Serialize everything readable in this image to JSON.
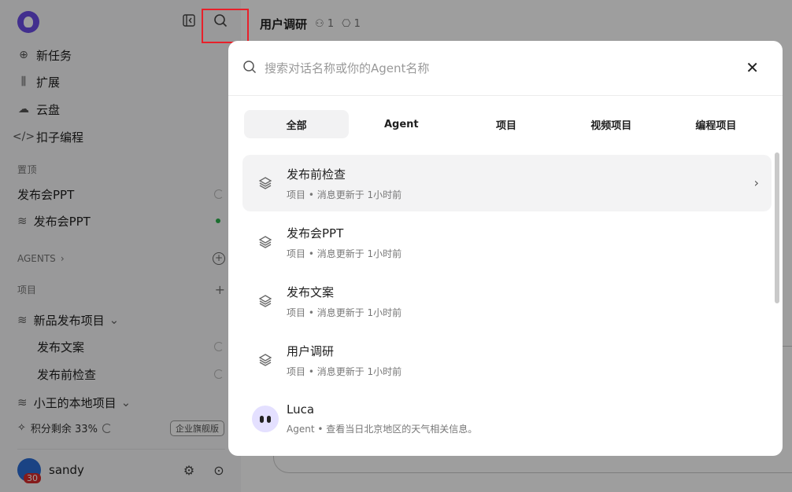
{
  "sidebar": {
    "nav": [
      {
        "label": "新任务",
        "icon": "plus-circle-icon"
      },
      {
        "label": "扩展",
        "icon": "library-icon"
      },
      {
        "label": "云盘",
        "icon": "cloud-icon"
      },
      {
        "label": "扣子编程",
        "icon": "code-icon"
      }
    ],
    "pinned_label": "置顶",
    "pinned": [
      {
        "label": "发布会PPT"
      },
      {
        "label": "发布会PPT"
      }
    ],
    "agents_label": "AGENTS",
    "projects_label": "项目",
    "projects": [
      {
        "label": "新品发布项目"
      },
      {
        "label": "发布文案"
      },
      {
        "label": "发布前检查"
      },
      {
        "label": "小王的本地项目"
      }
    ],
    "credit": "积分剩余 33%",
    "plan_badge": "企业旗舰版",
    "user": {
      "name": "sandy",
      "badge": "30"
    }
  },
  "header": {
    "title": "用户调研",
    "members": "1",
    "bots": "1"
  },
  "modal": {
    "search_placeholder": "搜索对话名称或你的Agent名称",
    "tabs": [
      "全部",
      "Agent",
      "项目",
      "视频项目",
      "编程项目"
    ],
    "items": [
      {
        "title": "发布前检查",
        "subtitle": "项目 • 消息更新于 1小时前",
        "icon": "layers-icon"
      },
      {
        "title": "发布会PPT",
        "subtitle": "项目 • 消息更新于 1小时前",
        "icon": "layers-icon"
      },
      {
        "title": "发布文案",
        "subtitle": "项目 • 消息更新于 1小时前",
        "icon": "layers-icon"
      },
      {
        "title": "用户调研",
        "subtitle": "项目 • 消息更新于 1小时前",
        "icon": "layers-icon"
      },
      {
        "title": "Luca",
        "subtitle": "Agent • 查看当日北京地区的天气相关信息。",
        "icon": "agent-avatar"
      }
    ]
  },
  "colors": {
    "highlight": "#e8202a",
    "accent": "#6b4de6",
    "online": "#2bb24c"
  }
}
